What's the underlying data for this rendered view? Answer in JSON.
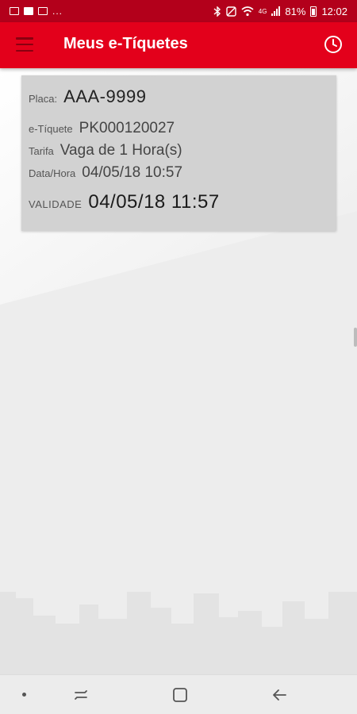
{
  "status_bar": {
    "notifications_overflow": "...",
    "network_type": "4G",
    "battery": "81%",
    "time": "12:02"
  },
  "app_bar": {
    "title": "Meus e-Tíquetes",
    "menu_icon": "hamburger-menu-icon",
    "history_icon": "clock-icon"
  },
  "ticket": {
    "placa_label": "Placa:",
    "placa_value": "AAA-9999",
    "eticket_label": "e-Tíquete",
    "eticket_value": "PK000120027",
    "tarifa_label": "Tarifa",
    "tarifa_value": "Vaga de 1 Hora(s)",
    "datahora_label": "Data/Hora",
    "datahora_value": "04/05/18 10:57",
    "validade_label": "VALIDADE",
    "validade_value": "04/05/18 11:57"
  },
  "nav_bar": {
    "recents_icon": "recents-icon",
    "home_icon": "home-icon",
    "back_icon": "back-arrow-icon"
  },
  "colors": {
    "status_bar": "#b3001b",
    "app_bar": "#e3001b",
    "card": "#d2d2d2",
    "background": "#f2f2f2"
  }
}
